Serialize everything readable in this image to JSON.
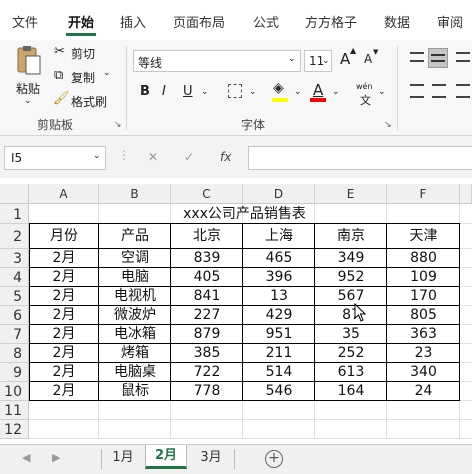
{
  "menu": {
    "tabs": [
      "文件",
      "开始",
      "插入",
      "页面布局",
      "公式",
      "方方格子",
      "数据",
      "审阅"
    ],
    "active": "开始"
  },
  "ribbon": {
    "clipboard": {
      "paste": "粘贴",
      "cut": "剪切",
      "copy": "复制",
      "format_painter": "格式刷",
      "label": "剪贴板"
    },
    "font": {
      "name": "等线",
      "size": "11",
      "grow": "A",
      "shrink": "A",
      "bold": "B",
      "italic": "I",
      "underline": "U",
      "phonetic_top": "wén",
      "phonetic_bottom": "文",
      "label": "字体"
    }
  },
  "formula_bar": {
    "name_box": "I5",
    "cancel": "✕",
    "enter": "✓",
    "fx": "fx",
    "value": ""
  },
  "sheet": {
    "columns": [
      "A",
      "B",
      "C",
      "D",
      "E",
      "F"
    ],
    "rows": [
      "1",
      "2",
      "3",
      "4",
      "5",
      "6",
      "7",
      "8",
      "9",
      "10",
      "11",
      "12"
    ],
    "title": "xxx公司产品销售表",
    "header": [
      "月份",
      "产品",
      "北京",
      "上海",
      "南京",
      "天津"
    ],
    "data": [
      [
        "2月",
        "空调",
        "839",
        "465",
        "349",
        "880"
      ],
      [
        "2月",
        "电脑",
        "405",
        "396",
        "952",
        "109"
      ],
      [
        "2月",
        "电视机",
        "841",
        "13",
        "567",
        "170"
      ],
      [
        "2月",
        "微波炉",
        "227",
        "429",
        "87",
        "805"
      ],
      [
        "2月",
        "电冰箱",
        "879",
        "951",
        "35",
        "363"
      ],
      [
        "2月",
        "烤箱",
        "385",
        "211",
        "252",
        "23"
      ],
      [
        "2月",
        "电脑桌",
        "722",
        "514",
        "613",
        "340"
      ],
      [
        "2月",
        "鼠标",
        "778",
        "546",
        "164",
        "24"
      ]
    ]
  },
  "sheet_tabs": {
    "tabs": [
      "1月",
      "2月",
      "3月"
    ],
    "active": "2月",
    "add": "+"
  },
  "colors": {
    "accent": "#217346",
    "highlight": "#ffff00",
    "font_color": "#ff0000"
  }
}
